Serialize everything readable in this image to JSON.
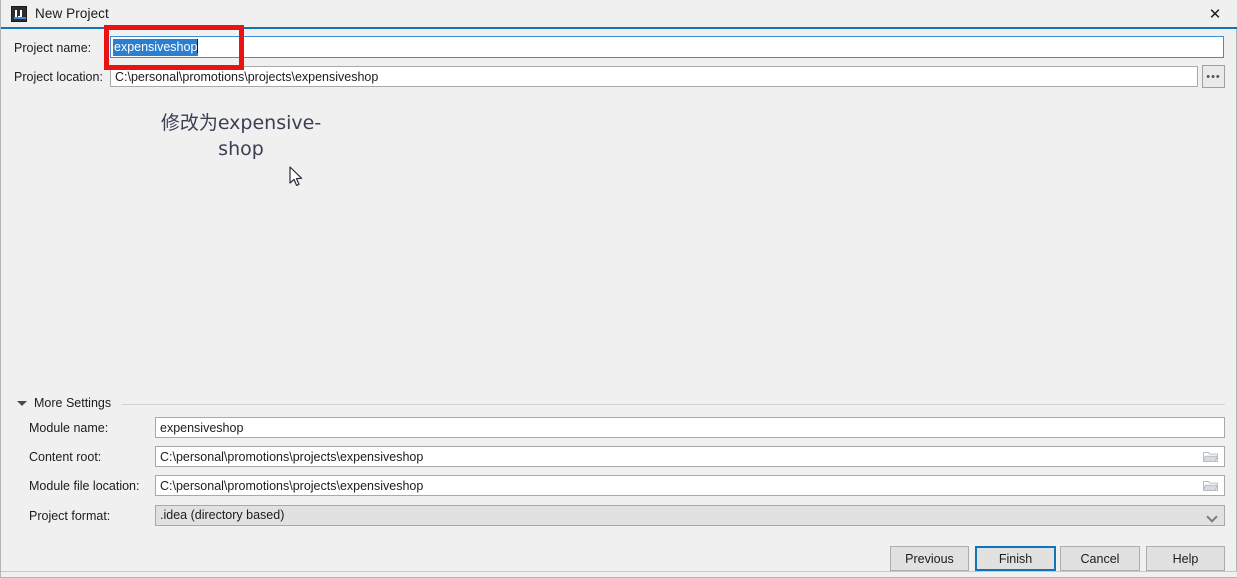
{
  "window": {
    "title": "New Project",
    "icon": "intellij-idea-logo",
    "close_label": "✕"
  },
  "form": {
    "project_name": {
      "label": "Project name:",
      "value": "expensiveshop",
      "selected": true
    },
    "project_location": {
      "label": "Project location:",
      "value": "C:\\personal\\promotions\\projects\\expensiveshop"
    },
    "browse_button_label": "•••"
  },
  "annotation": {
    "text": "修改为expensive-shop",
    "box_color": "#e81313",
    "text_color": "#3b3f52"
  },
  "more_settings": {
    "label": "More Settings",
    "expanded": true,
    "fields": [
      {
        "label": "Module name:",
        "value": "expensiveshop",
        "type": "text"
      },
      {
        "label": "Content root:",
        "value": "C:\\personal\\promotions\\projects\\expensiveshop",
        "type": "text-browse"
      },
      {
        "label": "Module file location:",
        "value": "C:\\personal\\promotions\\projects\\expensiveshop",
        "type": "text-browse"
      },
      {
        "label": "Project format:",
        "value": ".idea (directory based)",
        "type": "dropdown"
      }
    ]
  },
  "buttons": {
    "previous": "Previous",
    "finish": "Finish",
    "cancel": "Cancel",
    "help": "Help",
    "default_focus": "finish",
    "focus_color": "#1274b8"
  }
}
